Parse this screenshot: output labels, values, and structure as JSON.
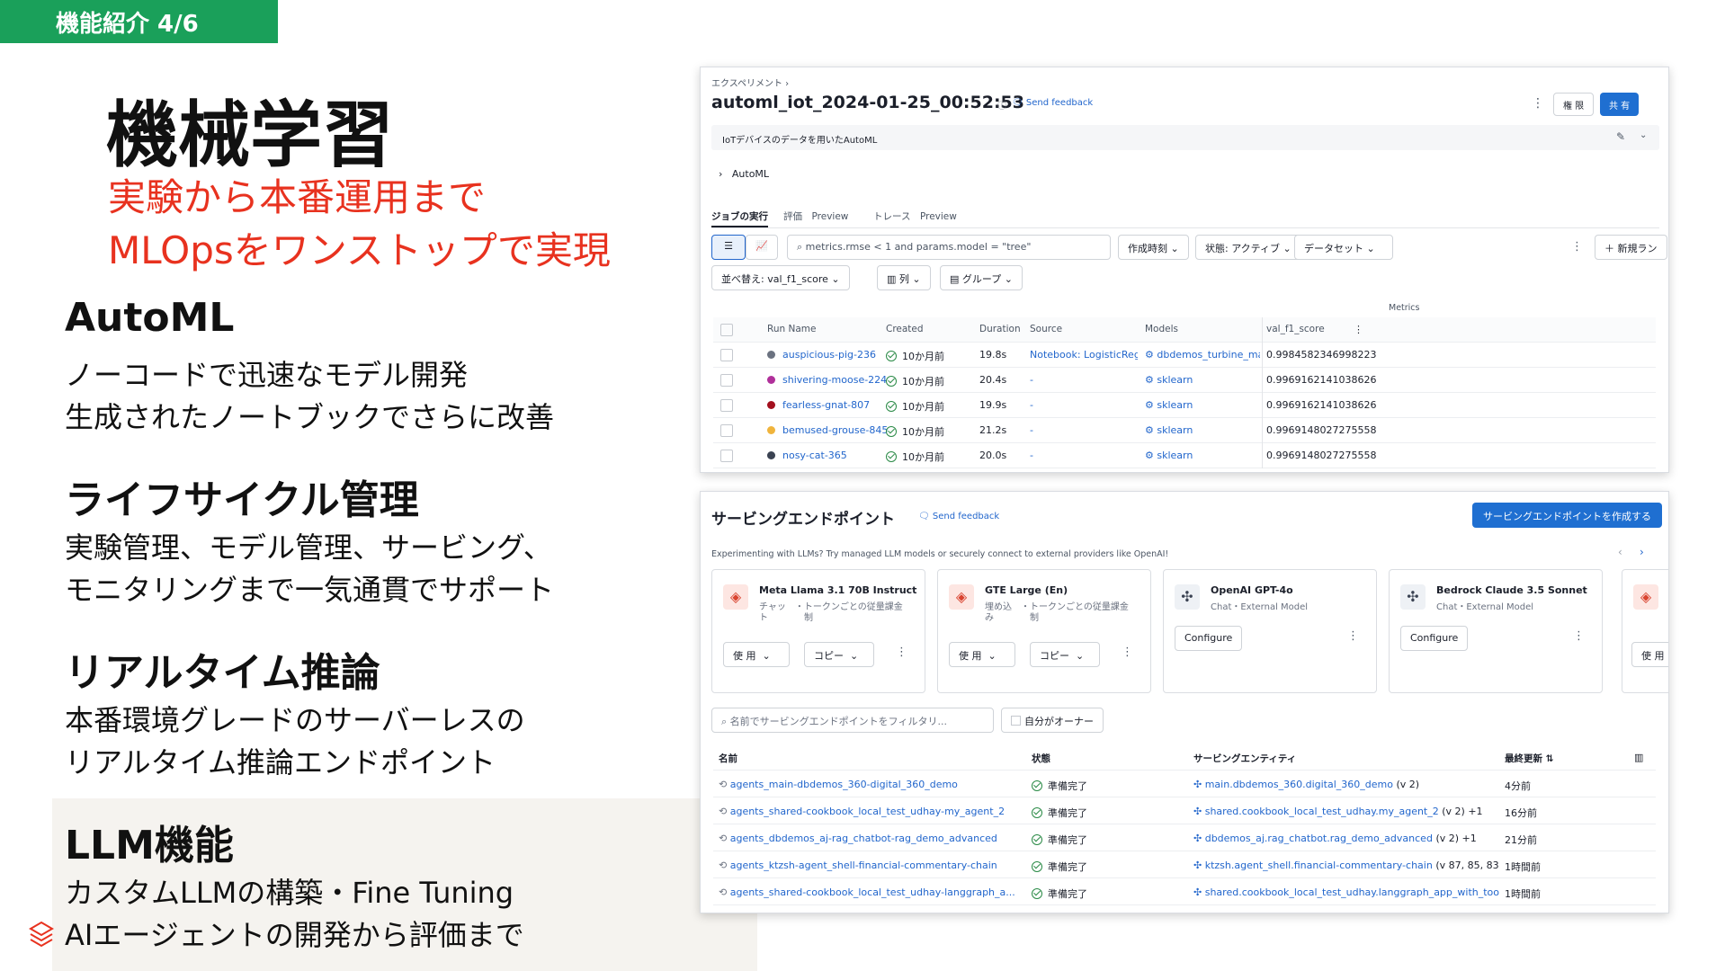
{
  "tag": "機能紹介 4/6",
  "title": "機械学習",
  "subtitle": [
    "実験から本番運用まで",
    "MLOpsをワンストップで実現"
  ],
  "sections": [
    {
      "h": "AutoML",
      "b": [
        "ノーコードで迅速なモデル開発",
        "生成されたノートブックでさらに改善"
      ]
    },
    {
      "h": "ライフサイクル管理",
      "b": [
        "実験管理、モデル管理、サービング、",
        "モニタリングまで一気通貫でサポート"
      ]
    },
    {
      "h": "リアルタイム推論",
      "b": [
        "本番環境グレードのサーバーレスの",
        "リアルタイム推論エンドポイント"
      ]
    },
    {
      "h": "LLM機能",
      "b": [
        "カスタムLLMの構築・Fine Tuning",
        "AIエージェントの開発から評価まで"
      ]
    }
  ],
  "exp": {
    "breadcrumb": "エクスペリメント ›",
    "title": "automl_iot_2024-01-25_00:52:53",
    "feedback": "Send feedback",
    "perm": "権 限",
    "share": "共 有",
    "desc": "IoTデバイスのデータを用いたAutoML",
    "automl": "AutoML",
    "tabs": [
      "ジョブの実行",
      "評価",
      "Preview",
      "トレース",
      "Preview"
    ],
    "search": "metrics.rmse < 1 and params.model = \"tree\"",
    "f_created": "作成時刻",
    "f_state": "状態: アクティブ",
    "f_dataset": "データセット",
    "new_run": "新規ラン",
    "sort": "並べ替え: val_f1_score",
    "cols": "列",
    "group": "グループ",
    "metrics_hdr": "Metrics",
    "headers": [
      "Run Name",
      "Created",
      "Duration",
      "Source",
      "Models",
      "val_f1_score"
    ],
    "rows": [
      {
        "name": "auspicious-pig-236",
        "color": "#6b7280",
        "created": "10か月前",
        "dur": "19.8s",
        "source": "Notebook: LogisticReg...",
        "model": "dbdemos_turbine_main...",
        "score": "0.9984582346998223"
      },
      {
        "name": "shivering-moose-224",
        "color": "#b0309a",
        "created": "10か月前",
        "dur": "20.4s",
        "source": "-",
        "model": "sklearn",
        "score": "0.9969162141038626"
      },
      {
        "name": "fearless-gnat-807",
        "color": "#a3101e",
        "created": "10か月前",
        "dur": "19.9s",
        "source": "-",
        "model": "sklearn",
        "score": "0.9969162141038626"
      },
      {
        "name": "bemused-grouse-845",
        "color": "#f0b43c",
        "created": "10か月前",
        "dur": "21.2s",
        "source": "-",
        "model": "sklearn",
        "score": "0.9969148027275558"
      },
      {
        "name": "nosy-cat-365",
        "color": "#3a4252",
        "created": "10か月前",
        "dur": "20.0s",
        "source": "-",
        "model": "sklearn",
        "score": "0.9969148027275558"
      }
    ]
  },
  "serv": {
    "title": "サービングエンドポイント",
    "feedback": "Send feedback",
    "create": "サービングエンドポイントを作成する",
    "note": "Experimenting with LLMs? Try managed LLM models or securely connect to external providers like OpenAI!",
    "cards": [
      {
        "t": "Meta Llama 3.1 70B Instruct",
        "s1": "チャッ　・トークンごとの従量課金",
        "s2": "ト　　　　制",
        "b1": "使 用",
        "b2": "コピー"
      },
      {
        "t": "GTE Large (En)",
        "s1": "埋め込　・トークンごとの従量課金",
        "s2": "み　　　　制",
        "b1": "使 用",
        "b2": "コピー"
      },
      {
        "t": "OpenAI GPT-4o",
        "s1": "Chat・External Model",
        "s2": "",
        "b1": "Configure",
        "b2": ""
      },
      {
        "t": "Bedrock Claude 3.5 Sonnet",
        "s1": "Chat・External Model",
        "s2": "",
        "b1": "Configure",
        "b2": ""
      }
    ],
    "fifth_btn": "使 用",
    "filter": "名前でサービングエンドポイントをフィルタリ...",
    "owner": "自分がオーナー",
    "headers": [
      "名前",
      "状態",
      "サービングエンティティ",
      "最終更新"
    ],
    "rows": [
      {
        "name": "agents_main-dbdemos_360-digital_360_demo",
        "state": "準備完了",
        "entity": "main.dbdemos_360.digital_360_demo",
        "ver": "(v 2)",
        "extra": "",
        "upd": "4分前"
      },
      {
        "name": "agents_shared-cookbook_local_test_udhay-my_agent_2",
        "state": "準備完了",
        "entity": "shared.cookbook_local_test_udhay.my_agent_2",
        "ver": "(v 2)",
        "extra": "+1",
        "upd": "16分前"
      },
      {
        "name": "agents_dbdemos_aj-rag_chatbot-rag_demo_advanced",
        "state": "準備完了",
        "entity": "dbdemos_aj.rag_chatbot.rag_demo_advanced",
        "ver": "(v 2)",
        "extra": "+1",
        "upd": "21分前"
      },
      {
        "name": "agents_ktzsh-agent_shell-financial-commentary-chain",
        "state": "準備完了",
        "entity": "ktzsh.agent_shell.financial-commentary-chain",
        "ver": "(v 87, 85, 83)",
        "extra": "",
        "upd": "1時間前"
      },
      {
        "name": "agents_shared-cookbook_local_test_udhay-langgraph_a...",
        "state": "準備完了",
        "entity": "shared.cookbook_local_test_udhay.langgraph_app_with_too",
        "ver": "",
        "extra": "",
        "upd": "1時間前"
      }
    ]
  }
}
